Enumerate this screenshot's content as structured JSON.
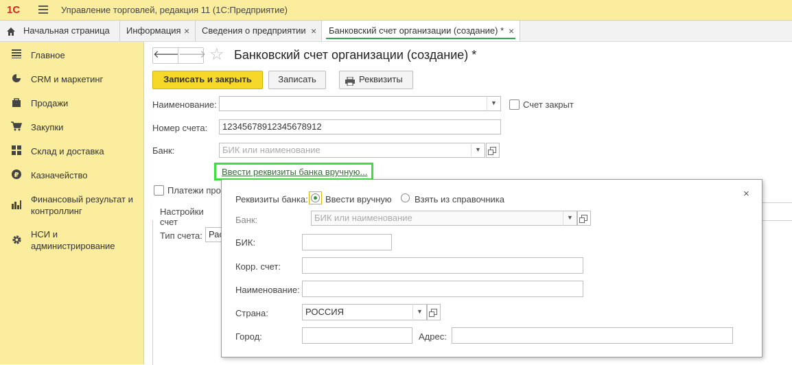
{
  "app": {
    "logo": "1С",
    "title": "Управление торговлей, редакция 11  (1С:Предприятие)"
  },
  "tabs": {
    "home": "Начальная страница",
    "items": [
      "Информация",
      "Сведения о предприятии",
      "Банковский счет организации (создание) *"
    ],
    "close_glyph": "×"
  },
  "sidebar": {
    "items": [
      {
        "label": "Главное",
        "icon": "list-icon"
      },
      {
        "label": "CRM и маркетинг",
        "icon": "pie-chart-icon"
      },
      {
        "label": "Продажи",
        "icon": "bag-icon"
      },
      {
        "label": "Закупки",
        "icon": "cart-icon"
      },
      {
        "label": "Склад и доставка",
        "icon": "grid-icon"
      },
      {
        "label": "Казначейство",
        "icon": "ruble-icon"
      },
      {
        "label": "Финансовый результат и контроллинг",
        "icon": "bar-chart-icon"
      },
      {
        "label": "НСИ и администрирование",
        "icon": "gear-icon"
      }
    ]
  },
  "form": {
    "title": "Банковский счет организации (создание) *",
    "buttons": {
      "save_close": "Записать и закрыть",
      "save": "Записать",
      "details": "Реквизиты"
    },
    "name_label": "Наименование:",
    "name_value": "",
    "closed_label": "Счет закрыт",
    "account_label": "Номер счета:",
    "account_value": "12345678912345678912",
    "bank_label": "Банк:",
    "bank_placeholder": "БИК или наименование",
    "manual_link": "Ввести реквизиты банка вручную...",
    "payments_label": "Платежи про",
    "settings_label": "Настройки счет",
    "type_label": "Тип счета:",
    "type_value": "Рас"
  },
  "popup": {
    "close_glyph": "×",
    "bank_details_label": "Реквизиты банка:",
    "option_manual": "Ввести вручную",
    "option_catalog": "Взять из справочника",
    "selected_option": "Ввести вручную",
    "bank_label": "Банк:",
    "bank_placeholder": "БИК или наименование",
    "bik_label": "БИК:",
    "corr_label": "Корр. счет:",
    "name_label": "Наименование:",
    "country_label": "Страна:",
    "country_value": "РОССИЯ",
    "city_label": "Город:",
    "address_label": "Адрес:"
  }
}
